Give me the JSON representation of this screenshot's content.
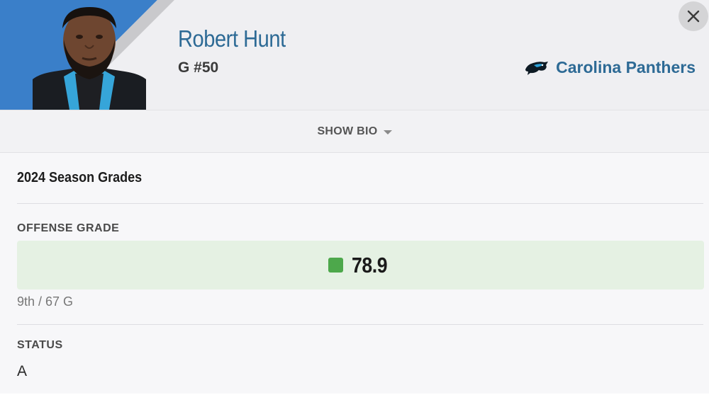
{
  "player": {
    "name": "Robert Hunt",
    "position_number": "G #50"
  },
  "team": {
    "name": "Carolina Panthers",
    "logo_icon": "panthers-logo-icon"
  },
  "header": {
    "close_icon": "close-icon",
    "accent_color": "#3a7fc9"
  },
  "bio": {
    "label": "SHOW BIO",
    "icon": "chevron-down-icon"
  },
  "season": {
    "title": "2024 Season Grades"
  },
  "offense": {
    "label": "OFFENSE GRADE",
    "grade": "78.9",
    "grade_color": "#4da84b",
    "rank": "9th / 67 G"
  },
  "status": {
    "label": "STATUS",
    "value": "A"
  }
}
